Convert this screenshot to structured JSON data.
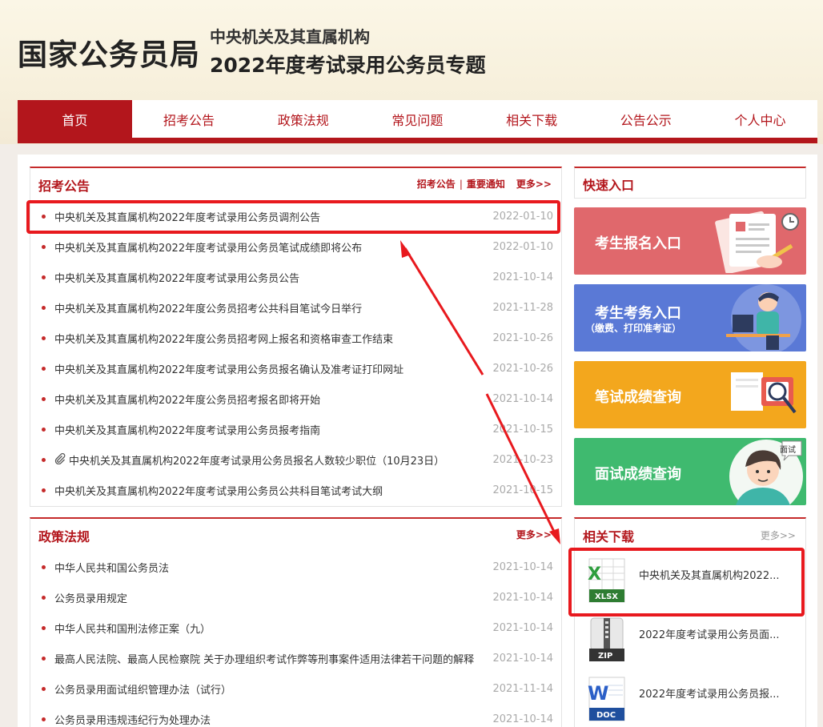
{
  "header": {
    "logo": "国家公务员局",
    "subtitle1": "中央机关及其直属机构",
    "subtitle2": "2022年度考试录用公务员专题"
  },
  "nav": [
    "首页",
    "招考公告",
    "政策法规",
    "常见问题",
    "相关下载",
    "公告公示",
    "个人中心"
  ],
  "recruit": {
    "title": "招考公告",
    "link1": "招考公告",
    "link2": "重要通知",
    "more": "更多>>",
    "items": [
      {
        "text": "中央机关及其直属机构2022年度考试录用公务员调剂公告",
        "date": "2022-01-10"
      },
      {
        "text": "中央机关及其直属机构2022年度考试录用公务员笔试成绩即将公布",
        "date": "2022-01-10"
      },
      {
        "text": "中央机关及其直属机构2022年度考试录用公务员公告",
        "date": "2021-10-14"
      },
      {
        "text": "中央机关及其直属机构2022年度公务员招考公共科目笔试今日举行",
        "date": "2021-11-28"
      },
      {
        "text": "中央机关及其直属机构2022年度公务员招考网上报名和资格审查工作结束",
        "date": "2021-10-26"
      },
      {
        "text": "中央机关及其直属机构2022年度考试录用公务员报名确认及准考证打印网址",
        "date": "2021-10-26"
      },
      {
        "text": "中央机关及其直属机构2022年度公务员招考报名即将开始",
        "date": "2021-10-14"
      },
      {
        "text": "中央机关及其直属机构2022年度考试录用公务员报考指南",
        "date": "2021-10-15"
      },
      {
        "text": "中央机关及其直属机构2022年度考试录用公务员报名人数较少职位（10月23日）",
        "date": "2021-10-23"
      },
      {
        "text": "中央机关及其直属机构2022年度考试录用公务员公共科目笔试考试大纲",
        "date": "2021-10-15"
      }
    ]
  },
  "policy": {
    "title": "政策法规",
    "more": "更多>>",
    "items": [
      {
        "text": "中华人民共和国公务员法",
        "date": "2021-10-14"
      },
      {
        "text": "公务员录用规定",
        "date": "2021-10-14"
      },
      {
        "text": "中华人民共和国刑法修正案（九）",
        "date": "2021-10-14"
      },
      {
        "text": "最高人民法院、最高人民检察院 关于办理组织考试作弊等刑事案件适用法律若干问题的解释",
        "date": "2021-10-14"
      },
      {
        "text": "公务员录用面试组织管理办法（试行）",
        "date": "2021-11-14"
      },
      {
        "text": "公务员录用违规违纪行为处理办法",
        "date": "2021-10-14"
      }
    ]
  },
  "quick": {
    "title": "快速入口",
    "items": [
      {
        "label": "考生报名入口",
        "sub": "",
        "color": "#e0686c"
      },
      {
        "label": "考生考务入口",
        "sub": "（缴费、打印准考证）",
        "color": "#5a79d6"
      },
      {
        "label": "笔试成绩查询",
        "sub": "",
        "color": "#f3a71d"
      },
      {
        "label": "面试成绩查询",
        "sub": "",
        "color": "#3fba6f"
      }
    ],
    "badge": "面试"
  },
  "downloads": {
    "title": "相关下载",
    "more": "更多>>",
    "items": [
      {
        "text": "中央机关及其直属机构2022...",
        "type": "XLSX"
      },
      {
        "text": "2022年度考试录用公务员面...",
        "type": "ZIP"
      },
      {
        "text": "2022年度考试录用公务员报...",
        "type": "DOC"
      }
    ]
  },
  "colors": {
    "brand": "#b3161c",
    "highlight": "#e8191e"
  }
}
